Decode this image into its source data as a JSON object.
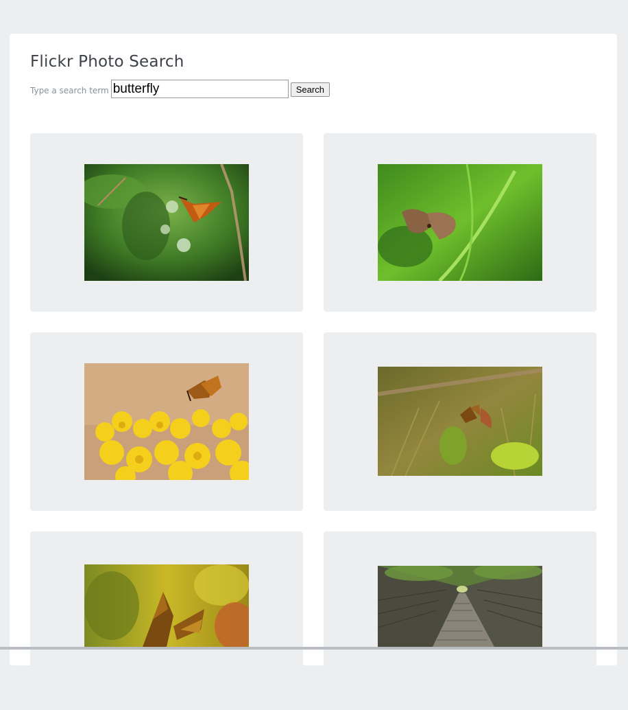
{
  "app": {
    "title": "Flickr Photo Search"
  },
  "search": {
    "label": "Type a search term",
    "value": "butterfly",
    "button_label": "Search"
  },
  "results": [
    {
      "subject": "skipper butterfly on fern"
    },
    {
      "subject": "brown butterfly on fern"
    },
    {
      "subject": "skipper on yellow flowers"
    },
    {
      "subject": "butterfly among grass"
    },
    {
      "subject": "skipper close-up"
    },
    {
      "subject": "mossy stone tunnel path"
    }
  ]
}
